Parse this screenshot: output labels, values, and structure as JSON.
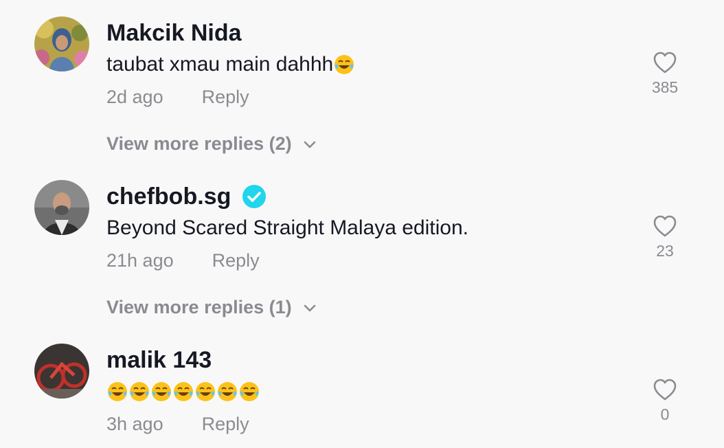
{
  "comments": [
    {
      "username": "Makcik Nida",
      "verified": false,
      "text": "taubat xmau main dahhh",
      "emoji_count": 1,
      "time": "2d ago",
      "reply_label": "Reply",
      "likes": "385",
      "view_more": "View more replies (2)"
    },
    {
      "username": "chefbob.sg",
      "verified": true,
      "text": "Beyond Scared Straight Malaya edition.",
      "emoji_count": 0,
      "time": "21h ago",
      "reply_label": "Reply",
      "likes": "23",
      "view_more": "View more replies (1)"
    },
    {
      "username": "malik 143",
      "verified": false,
      "text": "",
      "emoji_count": 7,
      "time": "3h ago",
      "reply_label": "Reply",
      "likes": "0"
    }
  ],
  "icons": {
    "like": "heart-outline-icon",
    "verified": "verified-badge-icon",
    "expand": "chevron-down-icon",
    "emoji": "face-with-tears-of-joy-emoji"
  },
  "colors": {
    "background": "#f8f8f8",
    "primary_text": "#161823",
    "secondary_text": "#8a8b91",
    "verified": "#20d5ec"
  }
}
